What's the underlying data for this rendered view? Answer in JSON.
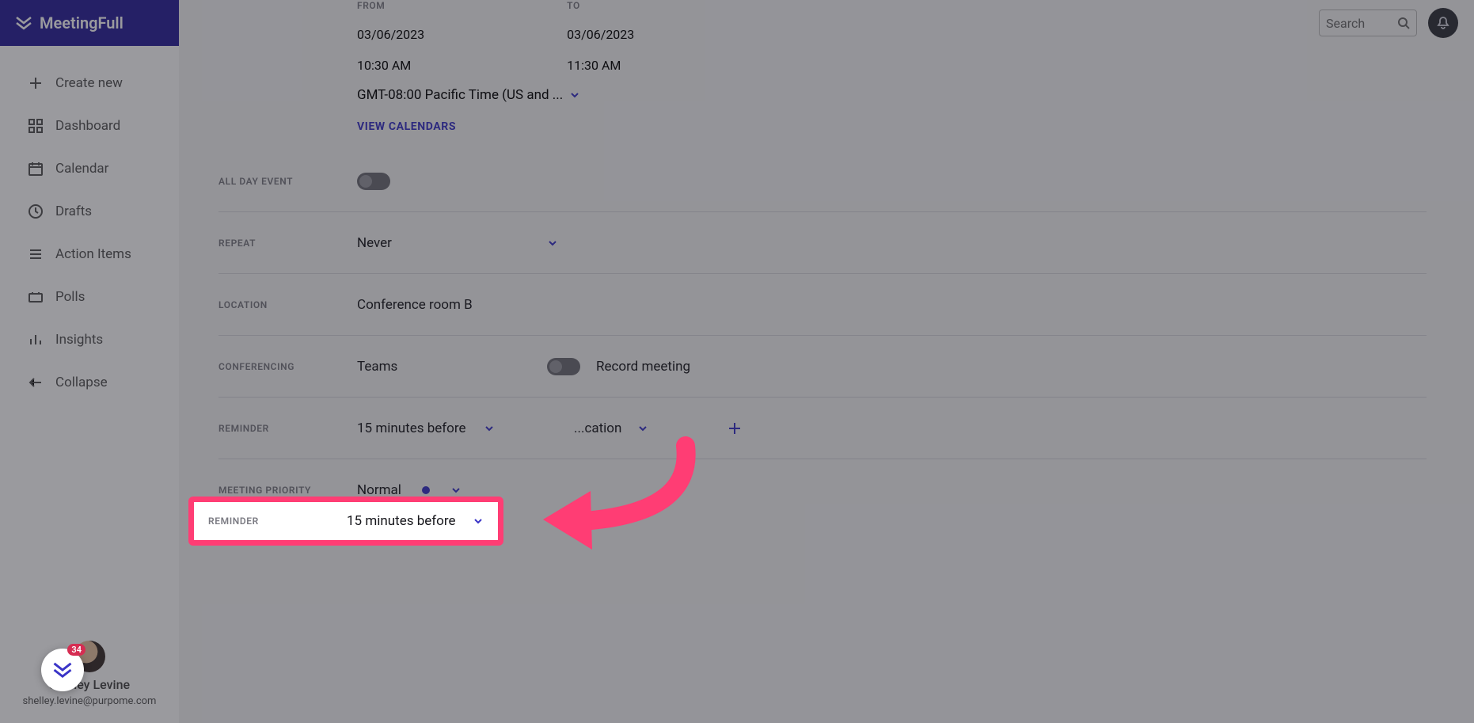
{
  "brand": {
    "name": "MeetingFull"
  },
  "sidebar": {
    "items": [
      {
        "label": "Create new"
      },
      {
        "label": "Dashboard"
      },
      {
        "label": "Calendar"
      },
      {
        "label": "Drafts"
      },
      {
        "label": "Action Items"
      },
      {
        "label": "Polls"
      },
      {
        "label": "Insights"
      },
      {
        "label": "Collapse"
      }
    ]
  },
  "user": {
    "name": "Shelley Levine",
    "name_partial": "ey Levine",
    "email": "shelley.levine@purpome.com",
    "email_partial": "e@purpome.com",
    "badge": "34"
  },
  "search": {
    "placeholder": "Search"
  },
  "form": {
    "from_label": "FROM",
    "to_label": "TO",
    "from_date": "03/06/2023",
    "from_time": "10:30 AM",
    "to_date": "03/06/2023",
    "to_time": "11:30 AM",
    "timezone": "GMT-08:00 Pacific Time (US and ...",
    "view_calendars": "VIEW CALENDARS",
    "all_day_label": "ALL DAY EVENT",
    "repeat_label": "REPEAT",
    "repeat_value": "Never",
    "location_label": "LOCATION",
    "location_value": "Conference room B",
    "conferencing_label": "CONFERENCING",
    "conferencing_value": "Teams",
    "record_label": "Record meeting",
    "reminder_label": "REMINDER",
    "reminder_value": "15 minutes before",
    "notification_partial": "...cation",
    "priority_label": "MEETING PRIORITY",
    "priority_value": "Normal"
  },
  "colors": {
    "accent": "#3a34c7",
    "highlight": "#ff3d74",
    "brand_bg": "#2a2199"
  }
}
